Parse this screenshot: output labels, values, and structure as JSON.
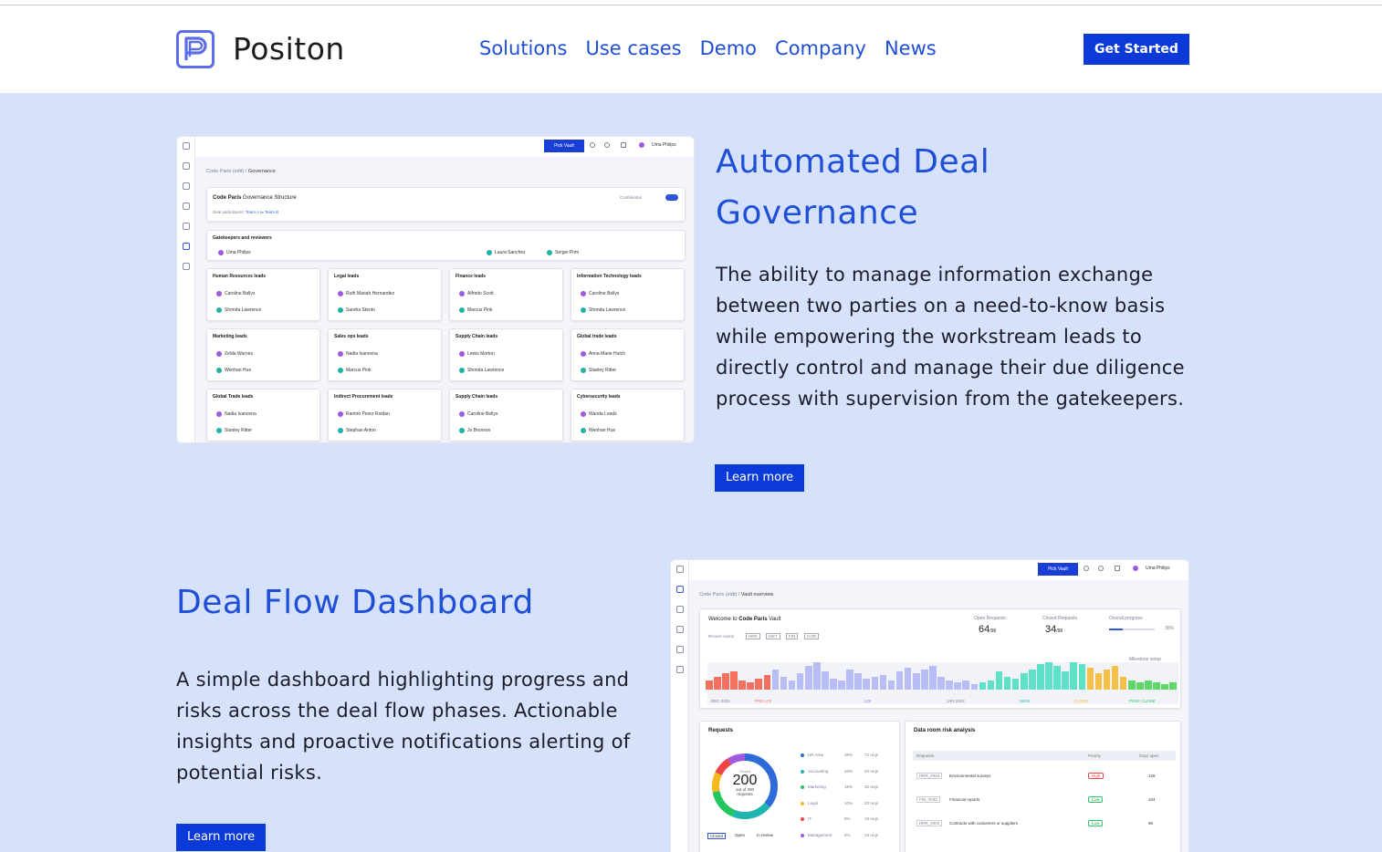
{
  "header": {
    "brand": "Positon",
    "nav": [
      "Solutions",
      "Use cases",
      "Demo",
      "Company",
      "News"
    ],
    "cta": "Get Started"
  },
  "governance": {
    "title_line1": "Automated Deal",
    "title_line2": "Governance",
    "description": "The ability to manage information exchange between two parties on a need-to-know basis while empowering the workstream leads to directly control and manage their due diligence process with supervision from the gatekeepers.",
    "cta": "Learn more",
    "shot": {
      "pick": "Pick Vault",
      "user": "Uma Philips",
      "crumb_a": "Code Paris (edit)",
      "crumb_b": "Governance",
      "card_title_bold": "Code Paris",
      "card_title_rest": " Governance Structure",
      "participants": "Deal participants:",
      "team_a": "Team A",
      "team_b": "Team B",
      "confidential": "Confidential",
      "gatekeepers_title": "Gatekeepers and reviewers",
      "gatekeepers": [
        "Uma Philips",
        "Laura Sanchez",
        "Sergei Prim"
      ],
      "groups": [
        {
          "title": "Human Resources leads",
          "people": [
            "Caroline Ballys",
            "Shonda Lawrence"
          ]
        },
        {
          "title": "Legal leads",
          "people": [
            "Ruth Mariah Hernandez",
            "Sandra Stento"
          ]
        },
        {
          "title": "Finance leads",
          "people": [
            "Alfredo Scott",
            "Marcus Pink"
          ]
        },
        {
          "title": "Information Technology leads",
          "people": [
            "Caroline Bellys",
            "Shonda Lawrence"
          ]
        },
        {
          "title": "Marketing leads",
          "people": [
            "Zelda Warnes",
            "Wenhan Hue"
          ]
        },
        {
          "title": "Sales ops leads",
          "people": [
            "Nadia Ivanovna",
            "Marcus Pink"
          ]
        },
        {
          "title": "Supply Chain leads",
          "people": [
            "Lewis Morton",
            "Shonda Lawrence"
          ]
        },
        {
          "title": "Global trade leads",
          "people": [
            "Anna Marie Hutch",
            "Stanley Ritter"
          ]
        },
        {
          "title": "Global Trade leads",
          "people": [
            "Nadia Ivanovna",
            "Stanley Ritter"
          ]
        },
        {
          "title": "Indirect Procurement leads",
          "people": [
            "Ramiro Perez Roldan",
            "Stephan Anton"
          ]
        },
        {
          "title": "Supply Chain leads",
          "people": [
            "Caroline Bellys",
            "Jo Bronson"
          ]
        },
        {
          "title": "Cybersecurity leads",
          "people": [
            "Wanda Leeds",
            "Wenhan Hue"
          ]
        }
      ]
    }
  },
  "dashboard": {
    "title": "Deal Flow Dashboard",
    "description": "A simple dashboard highlighting progress and risks across the deal flow phases. Actionable insights and proactive notifications alerting of potential risks.",
    "cta": "Learn more",
    "shot": {
      "pick": "Pick Vault",
      "user": "Uma Philips",
      "crumb_a": "Code Paris (edit)",
      "crumb_b": "Vault overview",
      "welcome": "Welcome to ",
      "welcome_bold": "Code Paris",
      "welcome_rest": " Vault",
      "recent": "Recent rooms",
      "rooms": [
        "HRR",
        "MKT",
        "FIN",
        "COR"
      ],
      "open_label": "Open Requests",
      "open_value": "64",
      "open_of": "/98",
      "closed_label": "Closed Requests",
      "closed_value": "34",
      "closed_of": "/98",
      "progress_label": "Overall progress",
      "progress_pct": "30%",
      "progress_value": 0.3,
      "milestone": "Milestone setup",
      "phases": [
        "DEC 2021",
        "PRE-LOI",
        "LOI",
        "JAN 2022",
        "SIGN",
        "CLOSE",
        "POST CLOSE"
      ],
      "requests_title": "Requests",
      "donut_top": "Closed",
      "donut_value": "200",
      "donut_sub1": "out of 300",
      "donut_sub2": "requests",
      "filters": [
        "Closed",
        "Open",
        "In review"
      ],
      "legend": [
        {
          "name": "HR Area",
          "pct": "36%",
          "reqs": "72 reqs",
          "color": "#2f6bd8"
        },
        {
          "name": "Accounting",
          "pct": "20%",
          "reqs": "40 reqs",
          "color": "#1fb5b0"
        },
        {
          "name": "Marketing",
          "pct": "16%",
          "reqs": "32 reqs",
          "color": "#22c55e"
        },
        {
          "name": "Legal",
          "pct": "10%",
          "reqs": "20 reqs",
          "color": "#f5b91e"
        },
        {
          "name": "IT",
          "pct": "9%",
          "reqs": "18 reqs",
          "color": "#ef4444"
        },
        {
          "name": "Management",
          "pct": "9%",
          "reqs": "18 reqs",
          "color": "#a05ae0"
        }
      ],
      "risk_title": "Data room risk analysis",
      "risk_cols": [
        "Requests",
        "Priority",
        "Days open"
      ],
      "risks": [
        {
          "id": "HRR_#023",
          "name": "Environmental surveys",
          "priority": "High",
          "days": "128"
        },
        {
          "id": "FIN_#033",
          "name": "Financial reports",
          "priority": "Low",
          "days": "104"
        },
        {
          "id": "HRR_#004",
          "name": "Contracts with customers or suppliers",
          "priority": "Low",
          "days": "96"
        }
      ]
    }
  },
  "colors": {
    "accent": "#0b3ad8",
    "link": "#1f4fd6",
    "bg": "#d6e2fb"
  }
}
